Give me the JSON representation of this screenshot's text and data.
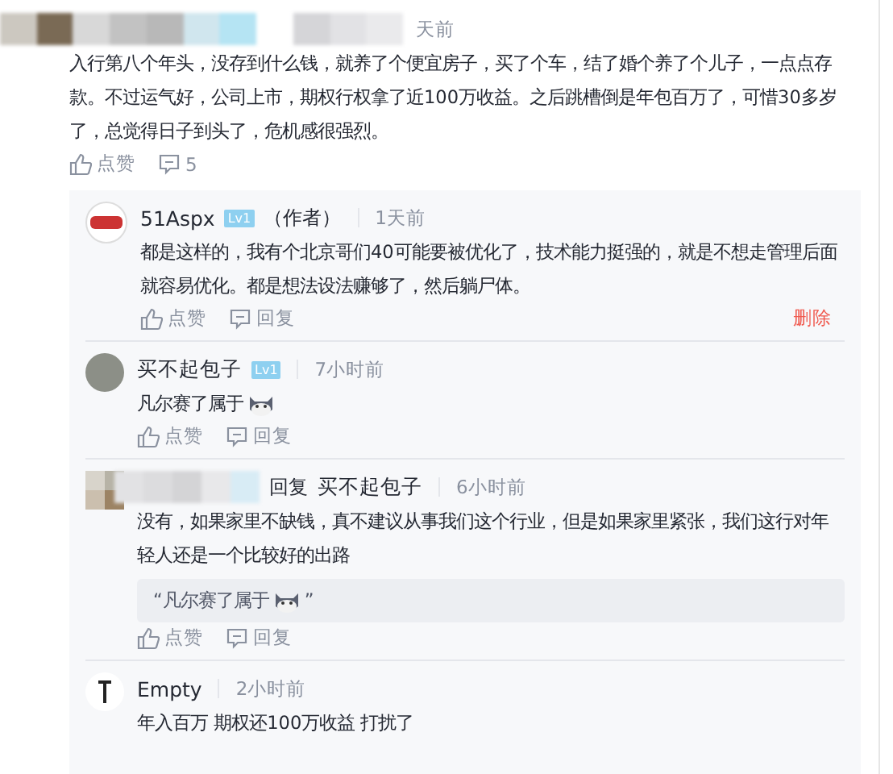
{
  "comment": {
    "time": "天前",
    "text": "入行第八个年头，没存到什么钱，就养了个便宜房子，买了个车，结了婚个养了个儿子，一点点存款。不过运气好，公司上市，期权行权拿了近100万收益。之后跳槽倒是年包百万了，可惜30多岁了，总觉得日子到头了，危机感很强烈。",
    "like_label": "点赞",
    "reply_count": "5"
  },
  "replies": [
    {
      "kind": "author",
      "name": "51Aspx",
      "level": "Lv1",
      "role": "（作者）",
      "time": "1天前",
      "text": "都是这样的，我有个北京哥们40可能要被优化了，技术能力挺强的，就是不想走管理后面就容易优化。都是想法设法赚够了，然后躺尸体。",
      "emoji": false,
      "like_label": "点赞",
      "reply_label": "回复",
      "delete_label": "删除"
    },
    {
      "kind": "plain",
      "name": "买不起包子",
      "level": "Lv1",
      "time": "7小时前",
      "text": "凡尔赛了属于",
      "emoji": true,
      "like_label": "点赞",
      "reply_label": "回复"
    },
    {
      "kind": "reply_to",
      "reply_to_label": "回复",
      "reply_to": "买不起包子",
      "time": "6小时前",
      "text": "没有，如果家里不缺钱，真不建议从事我们这个行业，但是如果家里紧张，我们这行对年轻人还是一个比较好的出路",
      "emoji": false,
      "quote": {
        "before": "“凡尔赛了属于",
        "after": "”",
        "emoji": true
      },
      "like_label": "点赞",
      "reply_label": "回复"
    },
    {
      "kind": "plain",
      "name": "Empty",
      "time": "2小时前",
      "text": "年入百万 期权还100万收益 打扰了",
      "emoji": false
    }
  ]
}
